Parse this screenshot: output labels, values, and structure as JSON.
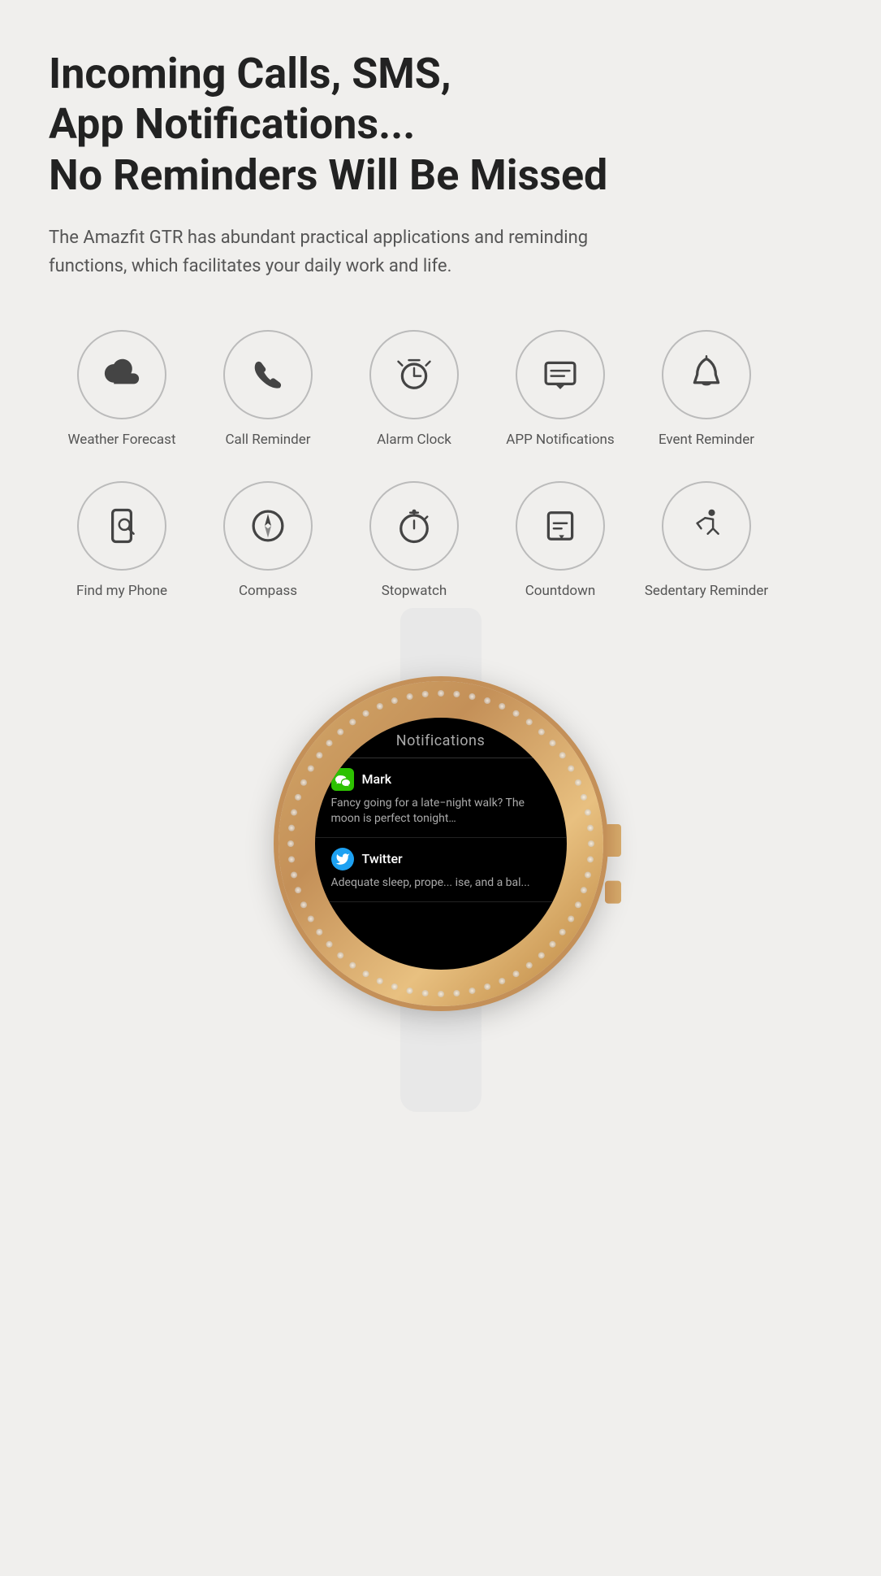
{
  "headline": {
    "line1": "Incoming Calls, SMS,",
    "line2": "App Notifications...",
    "line3": "No Reminders Will Be Missed"
  },
  "description": "The Amazfit GTR has abundant practical applications and reminding functions, which facilitates your daily work and life.",
  "icons": [
    {
      "id": "weather-forecast",
      "label": "Weather Forecast",
      "icon": "weather"
    },
    {
      "id": "call-reminder",
      "label": "Call Reminder",
      "icon": "phone"
    },
    {
      "id": "alarm-clock",
      "label": "Alarm Clock",
      "icon": "alarm"
    },
    {
      "id": "app-notifications",
      "label": "APP Notifications",
      "icon": "notification"
    },
    {
      "id": "event-reminder",
      "label": "Event Reminder",
      "icon": "bell"
    },
    {
      "id": "find-my-phone",
      "label": "Find my Phone",
      "icon": "findphone"
    },
    {
      "id": "compass",
      "label": "Compass",
      "icon": "compass"
    },
    {
      "id": "stopwatch",
      "label": "Stopwatch",
      "icon": "stopwatch"
    },
    {
      "id": "countdown",
      "label": "Countdown",
      "icon": "countdown"
    },
    {
      "id": "sedentary-reminder",
      "label": "Sedentary Reminder",
      "icon": "sedentary"
    }
  ],
  "watch": {
    "screen_title": "Notifications",
    "notifications": [
      {
        "app": "WeChat",
        "sender": "Mark",
        "text": "Fancy going for a late−night walk? The moon is perfect tonight…"
      },
      {
        "app": "Twitter",
        "sender": "Twitter",
        "text": "Adequate sleep, prope... ise, and a bal..."
      }
    ]
  }
}
